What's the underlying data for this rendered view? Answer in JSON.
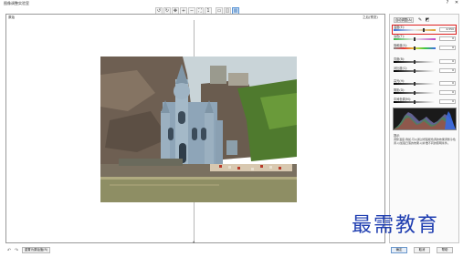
{
  "window": {
    "title": "图像调整实验室",
    "help_glyph": "?",
    "close_glyph": "✕"
  },
  "toolbar": {
    "tools": [
      {
        "name": "rotate-left-icon",
        "glyph": "↺"
      },
      {
        "name": "rotate-right-icon",
        "glyph": "↻"
      },
      {
        "name": "pan-icon",
        "glyph": "✥"
      },
      {
        "name": "zoom-in-icon",
        "glyph": "+"
      },
      {
        "name": "zoom-out-icon",
        "glyph": "−"
      },
      {
        "name": "fit-icon",
        "glyph": "⛶"
      },
      {
        "name": "actual-size-icon",
        "glyph": "1"
      },
      {
        "name": "single-view-icon",
        "glyph": "▭"
      },
      {
        "name": "split-view-icon",
        "glyph": "◫"
      },
      {
        "name": "before-after-icon",
        "glyph": "▥"
      }
    ]
  },
  "preview": {
    "left_label": "原始",
    "right_label": "之后(预览)"
  },
  "panel": {
    "auto_adjust_label": "自动调整(A)",
    "sliders": [
      {
        "label": "温度(E):",
        "value": "4,550",
        "position": 0.72,
        "name": "temperature-slider",
        "gradient": "linear-gradient(to right,#3a6fd8,#e8e8e8,#e0a030)"
      },
      {
        "label": "淡色(T):",
        "value": "0",
        "position": 0.5,
        "name": "tint-slider",
        "gradient": "linear-gradient(to right,#3cb84a,#e8e8e8,#c04ac8)"
      },
      {
        "label": "饱和度(S):",
        "value": "0",
        "position": 0.5,
        "name": "saturation-slider",
        "gradient": "linear-gradient(to right,#888,#e83a3a,#e8d23a,#3ac840,#3a6ae8)"
      },
      {
        "label": "亮度(B):",
        "value": "0",
        "position": 0.5,
        "name": "brightness-slider",
        "gradient": "linear-gradient(to right,#000,#fff)"
      },
      {
        "label": "对比度(C):",
        "value": "0",
        "position": 0.5,
        "name": "contrast-slider",
        "gradient": "linear-gradient(to right,#000,#fff)"
      },
      {
        "label": "高光(H):",
        "value": "0",
        "position": 0.5,
        "name": "highlights-slider",
        "gradient": "linear-gradient(to right,#000,#fff)"
      },
      {
        "label": "阴影(D):",
        "value": "0",
        "position": 0.5,
        "name": "shadows-slider",
        "gradient": "linear-gradient(to right,#000,#fff)"
      },
      {
        "label": "中间色调(M):",
        "value": "0",
        "position": 0.5,
        "name": "midtones-slider",
        "gradient": "linear-gradient(to right,#000,#fff)"
      }
    ],
    "tip_title": "提示",
    "tip_text": "调整温度,例如,可以通过增强暖色调的效果调整冷色调,以加强日落的效果,以补偿不同的照明条件。"
  },
  "footer": {
    "undo_glyph": "↶",
    "redo_glyph": "↷",
    "reset_label": "重置为原始值(R)",
    "ok_label": "确定",
    "cancel_label": "取消",
    "help_label": "帮助"
  },
  "watermark": "最需教育"
}
